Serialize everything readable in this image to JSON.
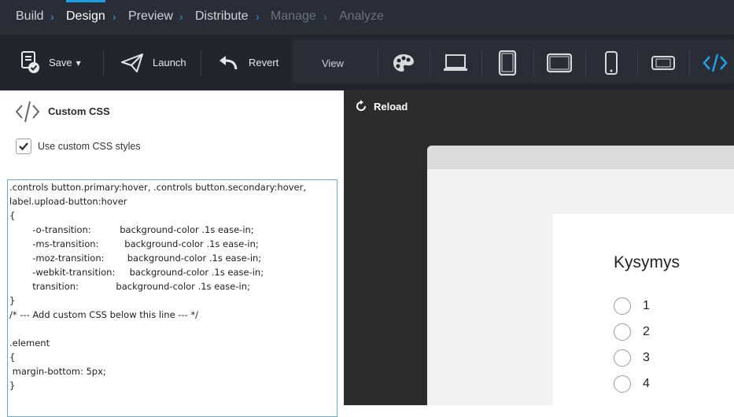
{
  "nav": {
    "items": [
      {
        "label": "Build"
      },
      {
        "label": "Design"
      },
      {
        "label": "Preview"
      },
      {
        "label": "Distribute"
      },
      {
        "label": "Manage"
      },
      {
        "label": "Analyze"
      }
    ],
    "separator": ">"
  },
  "toolbar": {
    "save_label": "Save",
    "save_caret": "▾",
    "launch_label": "Launch",
    "revert_label": "Revert",
    "view_label": "View",
    "view_icons": [
      "palette-icon",
      "desktop-icon",
      "tablet-portrait-icon",
      "tablet-landscape-icon",
      "phone-portrait-icon",
      "phone-landscape-icon",
      "code-icon"
    ]
  },
  "left_panel": {
    "title": "Custom CSS",
    "checkbox_label": "Use custom CSS styles",
    "checkbox_checked": true,
    "code_lines": [
      ".controls button.primary:hover, .controls button.secondary:hover,",
      "label.upload-button:hover",
      "{",
      "        -o-transition:          background-color .1s ease-in;",
      "        -ms-transition:         background-color .1s ease-in;",
      "        -moz-transition:        background-color .1s ease-in;",
      "        -webkit-transition:     background-color .1s ease-in;",
      "        transition:             background-color .1s ease-in;",
      "}",
      "/* --- Add custom CSS below this line --- */",
      "",
      ".element",
      "{",
      " margin-bottom: 5px;",
      "}"
    ]
  },
  "right_panel": {
    "reload_label": "Reload",
    "question_title": "Kysymys",
    "options": [
      "1",
      "2",
      "3",
      "4"
    ]
  },
  "colors": {
    "accent": "#1ea0e6",
    "nav_bg": "#2b2d36",
    "toolbar_bg": "#23252c",
    "preview_bg": "#2c2c2c"
  }
}
